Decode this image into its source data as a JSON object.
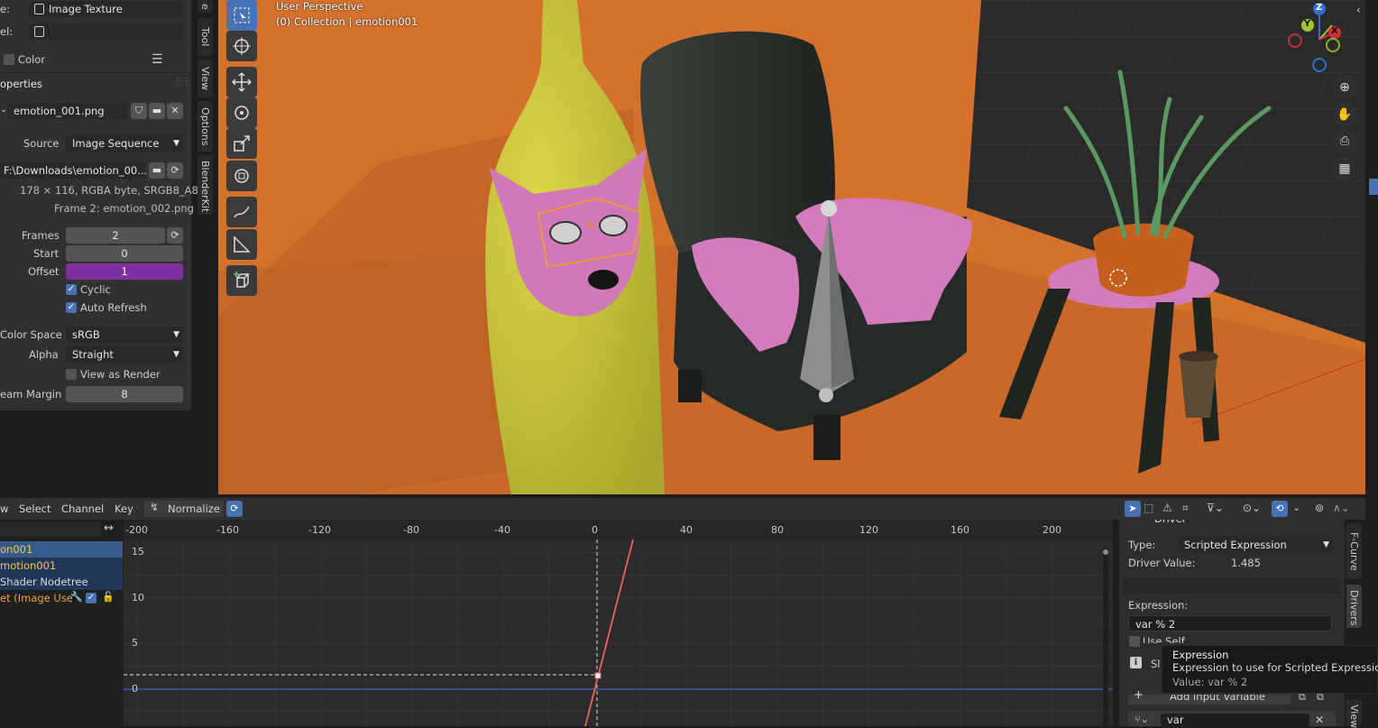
{
  "properties_panel": {
    "type_label": "e:",
    "type_value": "Image Texture",
    "label_label": "el:",
    "color_label": "Color",
    "section_title": "operties",
    "image_name": "emotion_001.png",
    "source_label": "Source",
    "source_value": "Image Sequence",
    "filepath": "F:\\Downloads\\emotion_00...",
    "info_size": "178 × 116,  RGBA byte, SRGB8_A8",
    "info_frame": "Frame 2: emotion_002.png",
    "frames_label": "Frames",
    "frames_value": "2",
    "start_label": "Start",
    "start_value": "0",
    "offset_label": "Offset",
    "offset_value": "1",
    "cyclic_label": "Cyclic",
    "auto_refresh_label": "Auto Refresh",
    "color_space_label": "Color Space",
    "color_space_value": "sRGB",
    "alpha_label": "Alpha",
    "alpha_value": "Straight",
    "view_as_render_label": "View as Render",
    "seam_margin_label": "eam Margin",
    "seam_margin_value": "8",
    "side_tabs": [
      "Tool",
      "View",
      "Options",
      "BlenderKit"
    ],
    "top_tab": "e"
  },
  "viewport": {
    "perspective": "User Perspective",
    "collection": "(0) Collection | emotion001",
    "gizmo_axes": [
      "Z",
      "Y",
      "X"
    ],
    "colors": {
      "orange_bg": "#d9742f",
      "floor": "#2e2e2e",
      "yellow": "#c9c438",
      "pink": "#d77ac3",
      "chair": "#2c302c"
    }
  },
  "graph_editor": {
    "menu": [
      "w",
      "Select",
      "Channel",
      "Key"
    ],
    "normalize_label": "Normalize",
    "x_ticks": [
      "-200",
      "-160",
      "-120",
      "-80",
      "-40",
      "0",
      "40",
      "80",
      "120",
      "160",
      "200"
    ],
    "y_ticks": [
      "15",
      "10",
      "5",
      "0"
    ],
    "channels": [
      "on001",
      "motion001",
      "Shader Nodetree",
      "et (Image Use"
    ],
    "driver_panel": {
      "header": "Driver",
      "type_label": "Type:",
      "type_value": "Scripted Expression",
      "driver_value_label": "Driver Value:",
      "driver_value": "1.485",
      "expression_label": "Expression:",
      "expression_value": "var % 2",
      "use_self_label": "Use Self",
      "slow_label": "Sl",
      "add_input_label": "Add Input Variable",
      "var_name": "var"
    },
    "side_tabs": [
      "F-Curve",
      "Drivers",
      "View"
    ],
    "tooltip": {
      "title": "Expression",
      "description": "Expression to use for Scripted Expression.",
      "value": "Value: var % 2"
    }
  }
}
